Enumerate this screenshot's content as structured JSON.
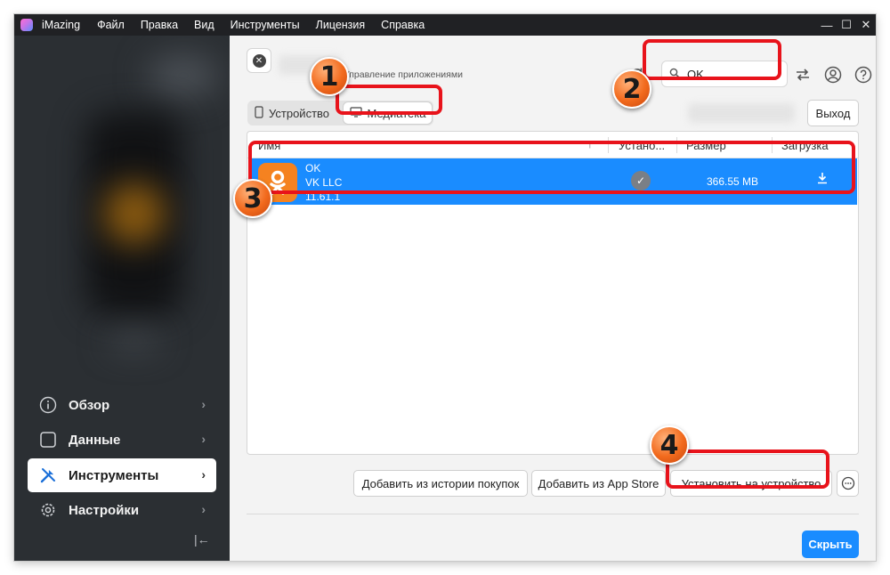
{
  "titlebar": {
    "app_name": "iMazing",
    "menu": [
      "Файл",
      "Правка",
      "Вид",
      "Инструменты",
      "Лицензия",
      "Справка"
    ],
    "controls": [
      "—",
      "☐",
      "✕"
    ]
  },
  "sidebar": {
    "items": [
      {
        "label": "Обзор",
        "icon": "info-icon"
      },
      {
        "label": "Данные",
        "icon": "square-icon"
      },
      {
        "label": "Инструменты",
        "icon": "tools-icon",
        "active": true
      },
      {
        "label": "Настройки",
        "icon": "gear-icon"
      }
    ],
    "collapse_glyph": "|←"
  },
  "header": {
    "breadcrumb": "Управление приложениями",
    "search_value": "OK",
    "exit_label": "Выход"
  },
  "segmented": {
    "device_label": "Устройство",
    "library_label": "Медиатека",
    "selected": "library"
  },
  "table": {
    "columns": [
      "Имя",
      "Устано...",
      "Размер",
      "Загрузка"
    ],
    "sort_glyph": "↑",
    "rows": [
      {
        "name": "OK",
        "developer": "VK LLC",
        "version": "11.61.1",
        "installed": true,
        "size": "366.55 MB",
        "selected": true
      }
    ]
  },
  "footer": {
    "history_btn": "Добавить из истории покупок",
    "appstore_btn": "Добавить из App Store",
    "install_btn": "Установить на устройство",
    "more_glyph": "···",
    "hide_btn": "Скрыть"
  },
  "annotations": [
    {
      "number": "1"
    },
    {
      "number": "2"
    },
    {
      "number": "3"
    },
    {
      "number": "4"
    }
  ],
  "colors": {
    "accent": "#1a8cff",
    "annotation_red": "#e8131b",
    "marker_orange": "#f26a1d",
    "ok_brand": "#f58220",
    "sidebar_bg": "#2b2f33"
  }
}
